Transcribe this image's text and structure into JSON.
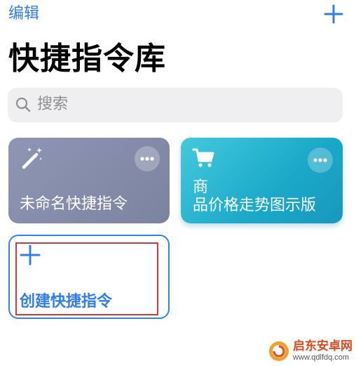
{
  "header": {
    "edit_label": "编辑",
    "add_icon": "plus-icon"
  },
  "page_title": "快捷指令库",
  "search": {
    "placeholder": "搜索",
    "icon": "search-icon"
  },
  "shortcuts": [
    {
      "label": "未命名快捷指令",
      "icon": "magic-wand-icon",
      "color": "#868da9",
      "more_icon": "ellipsis-icon"
    },
    {
      "label_lines": [
        "商",
        "品价格走势图示版"
      ],
      "icon": "shopping-cart-icon",
      "color": "#25b3d0",
      "more_icon": "ellipsis-icon"
    }
  ],
  "create": {
    "label": "创建快捷指令",
    "icon": "plus-icon"
  },
  "watermark": {
    "name": "启东安卓网",
    "url": "www.qdlfdq.com"
  },
  "colors": {
    "accent": "#2f7cf6",
    "highlight": "#d9363e",
    "search_bg": "#efeff1"
  }
}
